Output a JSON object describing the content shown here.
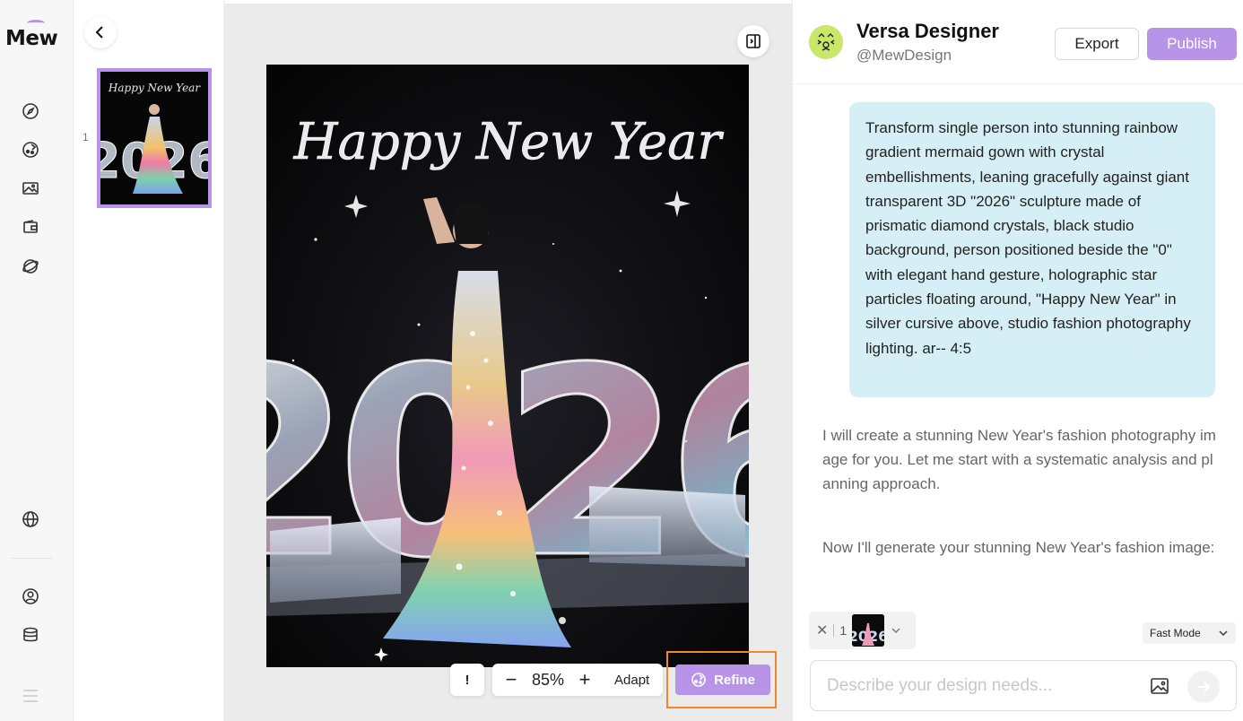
{
  "app": {
    "logo_text": "Mew"
  },
  "rail": {
    "icons": [
      "compass-icon",
      "palette-icon",
      "gallery-icon",
      "wallet-icon",
      "planet-icon",
      "globe-icon",
      "user-icon",
      "database-icon",
      "menu-icon"
    ]
  },
  "thumbnails": {
    "items": [
      {
        "index": "1",
        "label": "Happy New Year"
      }
    ]
  },
  "canvas": {
    "artwork": {
      "headline": "Happy New Year",
      "number": "2026"
    },
    "controls": {
      "info_label": "!",
      "zoom_out": "−",
      "zoom_value": "85%",
      "zoom_in": "+",
      "adapt_label": "Adapt",
      "refine_label": "Refine"
    }
  },
  "chat": {
    "agent_name": "Versa Designer",
    "agent_handle": "@MewDesign",
    "export_label": "Export",
    "publish_label": "Publish",
    "user_prompt": "Transform single person into stunning rainbow gradient mermaid gown with crystal embellishments, leaning gracefully against giant transparent 3D \"2026\" sculpture made of prismatic diamond crystals, black studio background, person positioned beside the \"0\" with elegant hand gesture, holographic star particles floating around, \"Happy New Year\" in silver cursive above, studio fashion photography lighting. ar-- 4:5",
    "ai_message_1": "I will create a stunning New Year's fashion photography image for you. Let me start with a systematic analysis and planning approach.",
    "ai_message_2": "Now I'll generate your stunning New Year's fashion image:",
    "attachment": {
      "count": "1"
    },
    "mode": "Fast Mode",
    "input_placeholder": "Describe your design needs..."
  },
  "colors": {
    "accent": "#b794e8",
    "highlight_border": "#f0882b",
    "user_bubble": "#d6eef5",
    "avatar_bg": "#c9e86a"
  }
}
